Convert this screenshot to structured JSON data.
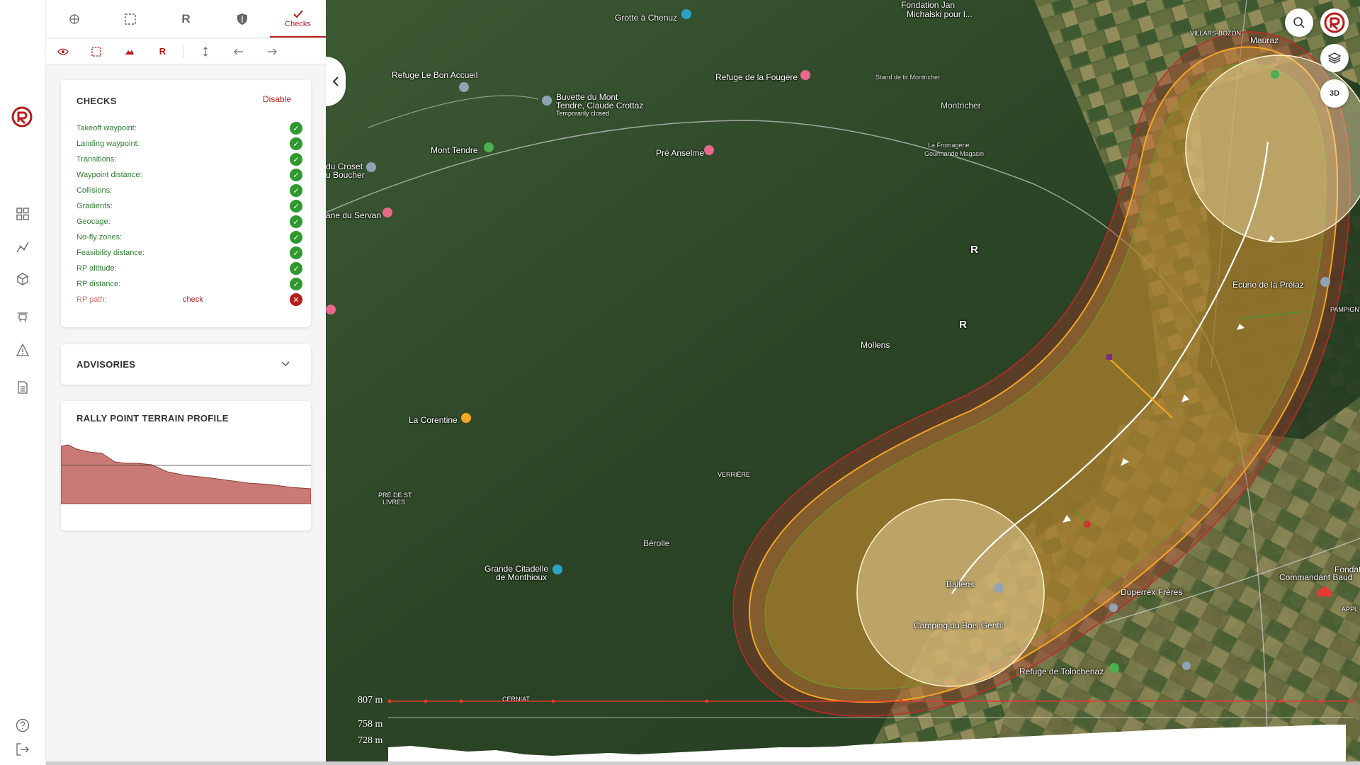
{
  "tabs": [
    {
      "icon": "crosshair-icon",
      "label": ""
    },
    {
      "icon": "selection-icon",
      "label": ""
    },
    {
      "icon": "rally-point-icon",
      "label": "R"
    },
    {
      "icon": "shield-icon",
      "label": ""
    },
    {
      "icon": "check-icon",
      "label": "Checks"
    }
  ],
  "subtoolbar": {
    "rally_label": "R"
  },
  "checks": {
    "title": "CHECKS",
    "disable_label": "Disable",
    "rows": [
      {
        "label": "Takeoff waypoint:",
        "status": "ok",
        "link": ""
      },
      {
        "label": "Landing waypoint:",
        "status": "ok",
        "link": ""
      },
      {
        "label": "Transitions:",
        "status": "ok",
        "link": ""
      },
      {
        "label": "Waypoint distance:",
        "status": "ok",
        "link": ""
      },
      {
        "label": "Collisions:",
        "status": "ok",
        "link": ""
      },
      {
        "label": "Gradients:",
        "status": "ok",
        "link": ""
      },
      {
        "label": "Geocage:",
        "status": "ok",
        "link": ""
      },
      {
        "label": "No-fly zones:",
        "status": "ok",
        "link": ""
      },
      {
        "label": "Feasibility distance:",
        "status": "ok",
        "link": ""
      },
      {
        "label": "RP altitude:",
        "status": "ok",
        "link": ""
      },
      {
        "label": "RP distance:",
        "status": "ok",
        "link": ""
      },
      {
        "label": "RP path:",
        "status": "fail",
        "link": "check"
      }
    ]
  },
  "advisories": {
    "title": "ADVISORIES"
  },
  "rally_profile": {
    "title": "RALLY POINT TERRAIN PROFILE"
  },
  "map": {
    "labels": [
      "Grotte à Chenuz",
      "Fondation Jan",
      "Michalski pour l...",
      "VILLARS-BOZON",
      "Mauraz",
      "Refuge Le Bon Accueil",
      "Buvette du Mont",
      "Tendre, Claude Crottaz",
      "Temporarily closed",
      "Refuge de la Fougère",
      "Stand de tir Montricher",
      "Montricher",
      "La Fromagerie",
      "Gourmande Magasin",
      "Mont Tendre",
      "Pré Anselme",
      "du Croset",
      "u Boucher",
      "ane du Servan",
      "Ecurie de la Prélaz",
      "PAMPIGNY",
      "Mollens",
      "La Corentine",
      "VERRIÈRE",
      "PRÉ DE ST",
      "LIVRES",
      "Bérolle",
      "Grande Citadelle",
      "de Monthioux",
      "Ballens",
      "Duperrex Frères",
      "Camping du Bois Gentil",
      "Fondation",
      "Commandant Baud",
      "Refuge de Tolochenaz",
      "CERNIAT",
      "APPL"
    ],
    "rally_markers": [
      "R",
      "R"
    ],
    "three_d_label": "3D"
  },
  "elevation": {
    "top_label": "807 m",
    "mid_label": "758 m",
    "low_label": "728 m"
  },
  "colors": {
    "accent": "#b71c1c",
    "ok": "#2e9a2e",
    "buffer_red": "#c62828",
    "buffer_orange": "#f5a623",
    "geocage_green": "#6a9a2a"
  }
}
